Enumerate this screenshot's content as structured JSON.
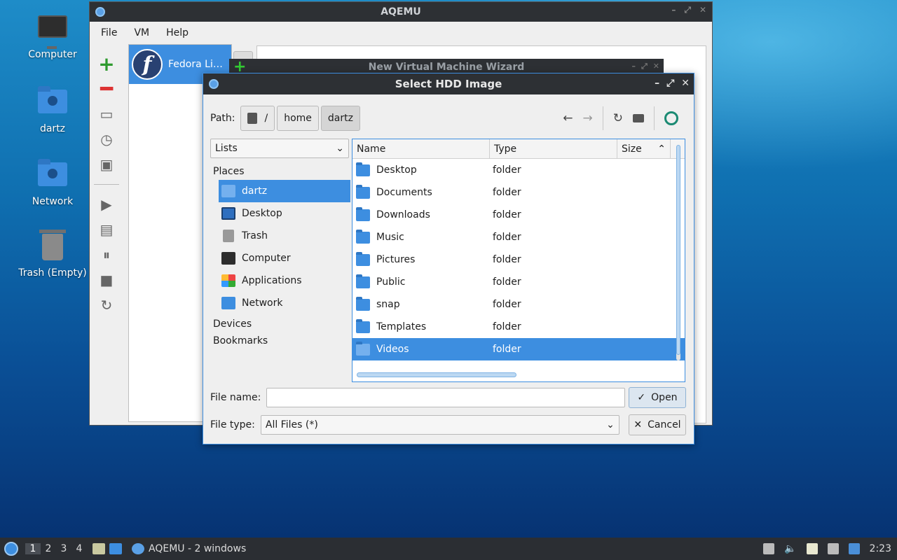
{
  "desktop": {
    "icons": [
      {
        "label": "Computer",
        "icon": "computer-icon"
      },
      {
        "label": "dartz",
        "icon": "home-folder-icon"
      },
      {
        "label": "Network",
        "icon": "network-folder-icon"
      },
      {
        "label": "Trash (Empty)",
        "icon": "trash-icon"
      }
    ]
  },
  "aqemu": {
    "title": "AQEMU",
    "menu": [
      "File",
      "VM",
      "Help"
    ],
    "vm_name": "Fedora Li…",
    "toolbar_icons": [
      "add-vm-icon",
      "remove-vm-icon",
      "hdd-icon",
      "clock-icon",
      "terminal-icon",
      "play-icon",
      "save-icon",
      "pause-icon",
      "stop-icon",
      "reset-icon"
    ]
  },
  "wizard": {
    "title": "New Virtual Machine Wizard"
  },
  "dialog": {
    "title": "Select HDD Image",
    "path_label": "Path:",
    "crumbs": [
      "/",
      "home",
      "dartz"
    ],
    "side_select": "Lists",
    "places_header": "Places",
    "places": [
      {
        "label": "dartz",
        "icon": "home-folder-icon",
        "selected": true
      },
      {
        "label": "Desktop",
        "icon": "desktop-icon",
        "selected": false
      },
      {
        "label": "Trash",
        "icon": "trash-icon",
        "selected": false
      },
      {
        "label": "Computer",
        "icon": "computer-icon",
        "selected": false
      },
      {
        "label": "Applications",
        "icon": "applications-icon",
        "selected": false
      },
      {
        "label": "Network",
        "icon": "network-folder-icon",
        "selected": false
      }
    ],
    "devices_header": "Devices",
    "bookmarks_header": "Bookmarks",
    "columns": [
      "Name",
      "Type",
      "Size"
    ],
    "files": [
      {
        "name": "Desktop",
        "type": "folder",
        "selected": false
      },
      {
        "name": "Documents",
        "type": "folder",
        "selected": false
      },
      {
        "name": "Downloads",
        "type": "folder",
        "selected": false
      },
      {
        "name": "Music",
        "type": "folder",
        "selected": false
      },
      {
        "name": "Pictures",
        "type": "folder",
        "selected": false
      },
      {
        "name": "Public",
        "type": "folder",
        "selected": false
      },
      {
        "name": "snap",
        "type": "folder",
        "selected": false
      },
      {
        "name": "Templates",
        "type": "folder",
        "selected": false
      },
      {
        "name": "Videos",
        "type": "folder",
        "selected": true
      }
    ],
    "file_name_label": "File name:",
    "file_name_value": "",
    "file_type_label": "File type:",
    "file_type_value": "All Files (*)",
    "open_label": "Open",
    "cancel_label": "Cancel"
  },
  "taskbar": {
    "desktops": [
      "1",
      "2",
      "3",
      "4"
    ],
    "active_desktop": "1",
    "app_label": "AQEMU - 2 windows",
    "clock": "2:23"
  },
  "colors": {
    "accent": "#3d8ee0",
    "titlebar": "#2d3034",
    "taskbar": "#2b2e33"
  }
}
